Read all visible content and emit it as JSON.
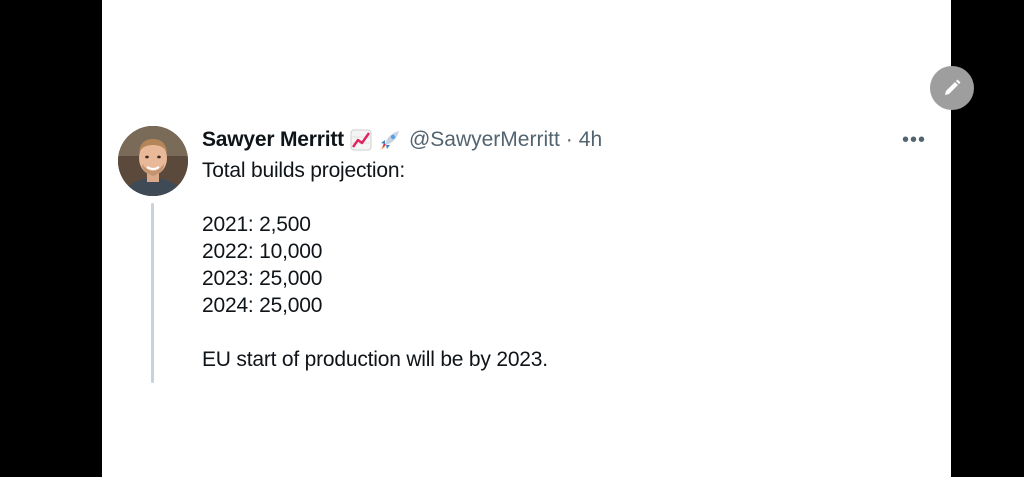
{
  "tweet": {
    "author_name": "Sawyer Merritt",
    "author_emojis": [
      "chart-increasing-icon",
      "rocket-icon"
    ],
    "handle": "@SawyerMerritt",
    "separator": "·",
    "time": "4h",
    "lines": [
      "Total builds projection:",
      "",
      "2021: 2,500",
      "2022: 10,000",
      "2023: 25,000",
      "2024: 25,000",
      "",
      "EU start of production will be by 2023."
    ],
    "more_label": "•••"
  },
  "colors": {
    "primary_text": "#0f1419",
    "secondary_text": "#536471",
    "thread_line": "#c9d2da",
    "fab": "#9e9e9e"
  }
}
